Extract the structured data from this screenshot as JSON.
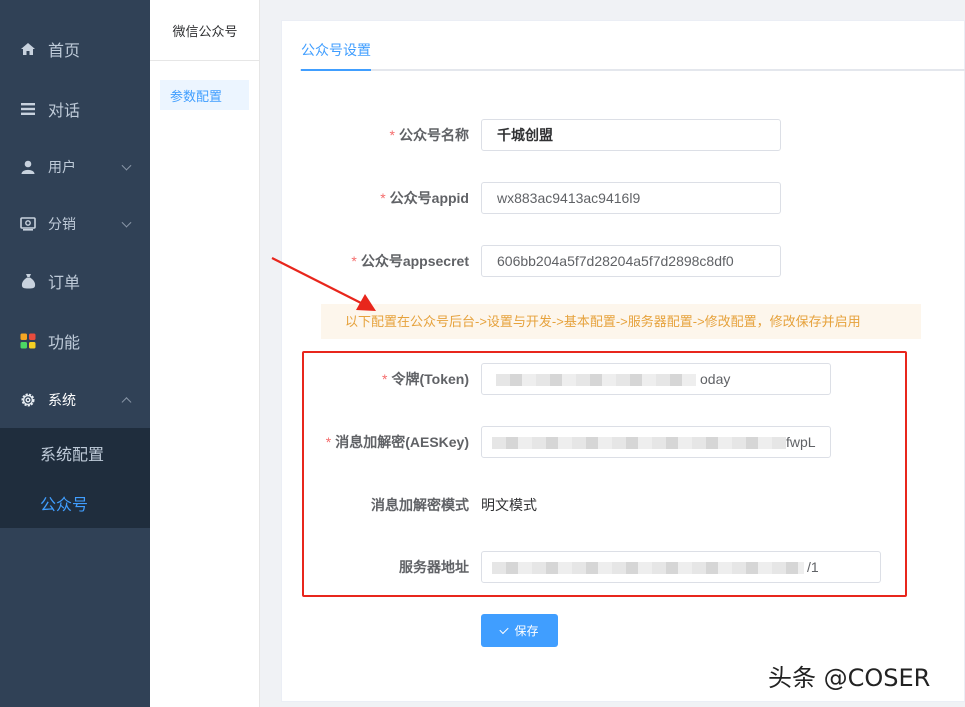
{
  "sidebar": {
    "items": [
      {
        "label": "首页",
        "icon": "home-icon"
      },
      {
        "label": "对话",
        "icon": "list-icon"
      },
      {
        "label": "用户",
        "icon": "user-icon"
      },
      {
        "label": "分销",
        "icon": "distribution-icon"
      },
      {
        "label": "订单",
        "icon": "money-bag-icon"
      },
      {
        "label": "功能",
        "icon": "apps-icon"
      },
      {
        "label": "系统",
        "icon": "gear-icon"
      }
    ],
    "submenu": [
      {
        "label": "系统配置"
      },
      {
        "label": "公众号"
      }
    ]
  },
  "secondary_nav": {
    "title": "微信公众号",
    "items": [
      {
        "label": "参数配置"
      }
    ]
  },
  "tabs": [
    {
      "label": "公众号设置"
    }
  ],
  "form": {
    "name": {
      "label": "公众号名称",
      "value": "千城创盟"
    },
    "appid": {
      "label": "公众号appid",
      "value": "wx883ac9413ac9416l9"
    },
    "appsecret": {
      "label": "公众号appsecret",
      "value": "606bb204a5f7d28204a5f7d2898c8df0"
    },
    "notice": "以下配置在公众号后台->设置与开发->基本配置->服务器配置->修改配置，修改保存并启用",
    "token": {
      "label": "令牌(Token)",
      "value_tail": "oday"
    },
    "aeskey": {
      "label": "消息加解密(AESKey)",
      "value_tail": "fwpL"
    },
    "mode": {
      "label": "消息加解密模式",
      "value": "明文模式"
    },
    "server": {
      "label": "服务器地址",
      "value_tail": "/1"
    },
    "required_mark": "*",
    "save_label": "保存"
  },
  "watermark": "头条 @COSER",
  "colors": {
    "sidebar_bg": "#304156",
    "submenu_bg": "#1f2d3d",
    "accent": "#409eff",
    "required": "#f56c6c",
    "notice_bg": "#fdf6ec",
    "notice_text": "#e6a23c",
    "highlight_box": "#e8261c"
  }
}
